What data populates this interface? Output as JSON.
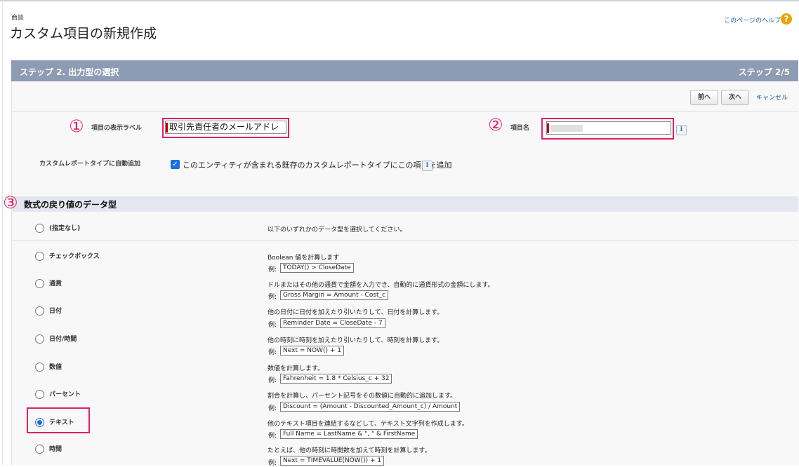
{
  "breadcrumb": "商談",
  "page_title": "カスタム項目の新規作成",
  "help_link": "このページのヘルプ",
  "step_bar": {
    "title": "ステップ 2. 出力型の選択",
    "counter": "ステップ 2/5"
  },
  "buttons": {
    "prev": "前へ",
    "next": "次へ",
    "cancel": "キャンセル"
  },
  "markers": {
    "m1": "①",
    "m2": "②",
    "m3": "③"
  },
  "field_label": {
    "label": "項目の表示ラベル",
    "value": "取引先責任者のメールアドレ"
  },
  "field_name": {
    "label": "項目名"
  },
  "info_glyph": "i",
  "auto_add": {
    "label": "カスタムレポートタイプに自動追加",
    "checkbox_label": "このエンティティが含まれる既存のカスタムレポートタイプにこの項目を追加",
    "checked_glyph": "✓"
  },
  "section_title": "数式の戻り値のデータ型",
  "example_prefix": "例:",
  "options": [
    {
      "label": "(指定なし)",
      "desc": "以下のいずれかのデータ型を選択してください。",
      "example": ""
    },
    {
      "label": "チェックボックス",
      "desc": "Boolean 値を計算します",
      "example": "TODAY() > CloseDate"
    },
    {
      "label": "通貨",
      "desc": "ドルまたはその他の通貨で金額を入力でき、自動的に通貨形式の金額にします。",
      "example": "Gross Margin = Amount - Cost_c"
    },
    {
      "label": "日付",
      "desc": "他の日付に日付を加えたり引いたりして、日付を計算します。",
      "example": "Reminder Date = CloseDate - 7"
    },
    {
      "label": "日付/時間",
      "desc": "他の時刻に時刻を加えたり引いたりして、時刻を計算します。",
      "example": "Next = NOW() + 1"
    },
    {
      "label": "数値",
      "desc": "数値を計算します。",
      "example": "Fahrenheit = 1.8 * Celsius_c + 32"
    },
    {
      "label": "パーセント",
      "desc": "割合を計算し、パーセント記号をその数値に自動的に追加します。",
      "example": "Discount = (Amount - Discounted_Amount_c) / Amount"
    },
    {
      "label": "テキスト",
      "desc": "他のテキスト項目を連結するなどして、テキスト文字列を作成します。",
      "example": "Full Name = LastName & \", \" & FirstName"
    },
    {
      "label": "時間",
      "desc": "たとえば、他の時刻に時間数を加えて時刻を計算します。",
      "example": "Next = TIMEVALUE(NOW()) + 1"
    }
  ],
  "colors": {
    "step_bar": "#8d9bb3",
    "highlight": "#e0206a",
    "radio_selected": "#1c6fe0",
    "link": "#1a5f9b"
  }
}
